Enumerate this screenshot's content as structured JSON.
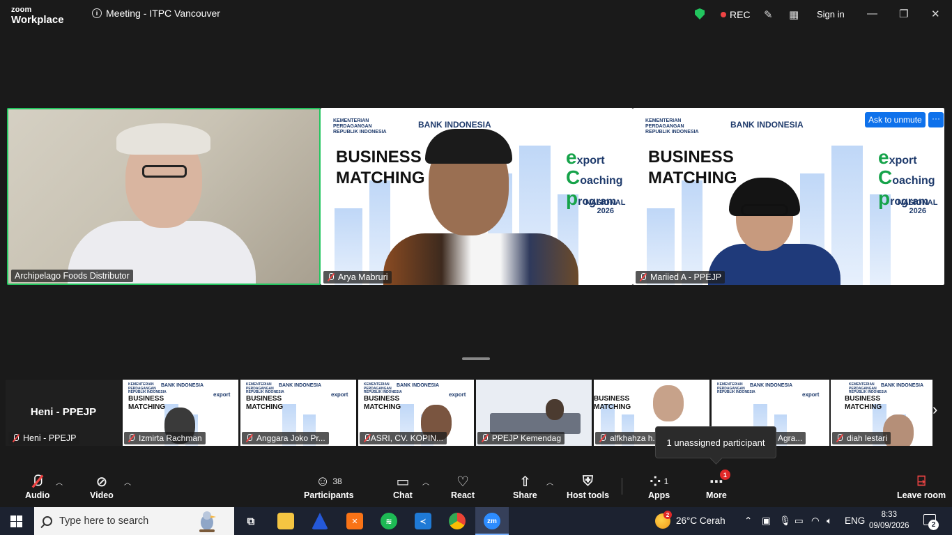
{
  "app": {
    "brand_line1": "zoom",
    "brand_line2": "Workplace",
    "meeting_title": "Meeting - ITPC Vancouver"
  },
  "titlebar": {
    "rec_label": "REC",
    "sign_in": "Sign in"
  },
  "main_tiles": [
    {
      "name": "Archipelago Foods Distributor",
      "active_speaker": true
    },
    {
      "name": "Arya Mabruri",
      "muted": true
    },
    {
      "name": "Mariied A - PPEJP",
      "muted": true
    }
  ],
  "slide": {
    "ministry": "KEMENTERIAN\nPERDAGANGAN\nREPUBLIK INDONESIA",
    "bank": "BANK INDONESIA",
    "headline_1": "BUSINESS",
    "headline_2": "MATCHING",
    "program_1": "xport",
    "program_2": "oaching",
    "program_3": "rogram",
    "program_e": "e",
    "program_c": "C",
    "program_p": "p",
    "program_edition": "NASIONAL",
    "program_year": "2026"
  },
  "ask_unmute_label": "Ask to unmute",
  "more_options_label": "···",
  "filmstrip": {
    "self_name": "Heni - PPEJP",
    "self_label": "Heni - PPEJP",
    "tiles": [
      {
        "name": "Izmirta Rachman"
      },
      {
        "name": "Anggara Joko Pr..."
      },
      {
        "name": "ASRI, CV. KOPIN..."
      },
      {
        "name": "PPEJP Kemendag"
      },
      {
        "name": "alfkhahza h..."
      },
      {
        "name": "Agra..."
      },
      {
        "name": "diah lestari"
      }
    ],
    "tooltip": "1 unassigned participant",
    "next_arrow": "›"
  },
  "toolbar": {
    "audio": "Audio",
    "video": "Video",
    "participants": "Participants",
    "participants_count": "38",
    "chat": "Chat",
    "react": "React",
    "share": "Share",
    "host_tools": "Host tools",
    "apps": "Apps",
    "apps_count": "1",
    "more": "More",
    "more_badge": "1",
    "leave": "Leave room"
  },
  "taskbar": {
    "search_placeholder": "Type here to search",
    "weather_badge": "2",
    "weather": "26°C  Cerah",
    "lang": "ENG",
    "time": "8:33",
    "date": "09/09/2026",
    "notif_count": "2"
  },
  "colors": {
    "accent": "#0e71eb",
    "active_border": "#22c55e",
    "rec": "#ef4444",
    "badge": "#e02828"
  }
}
